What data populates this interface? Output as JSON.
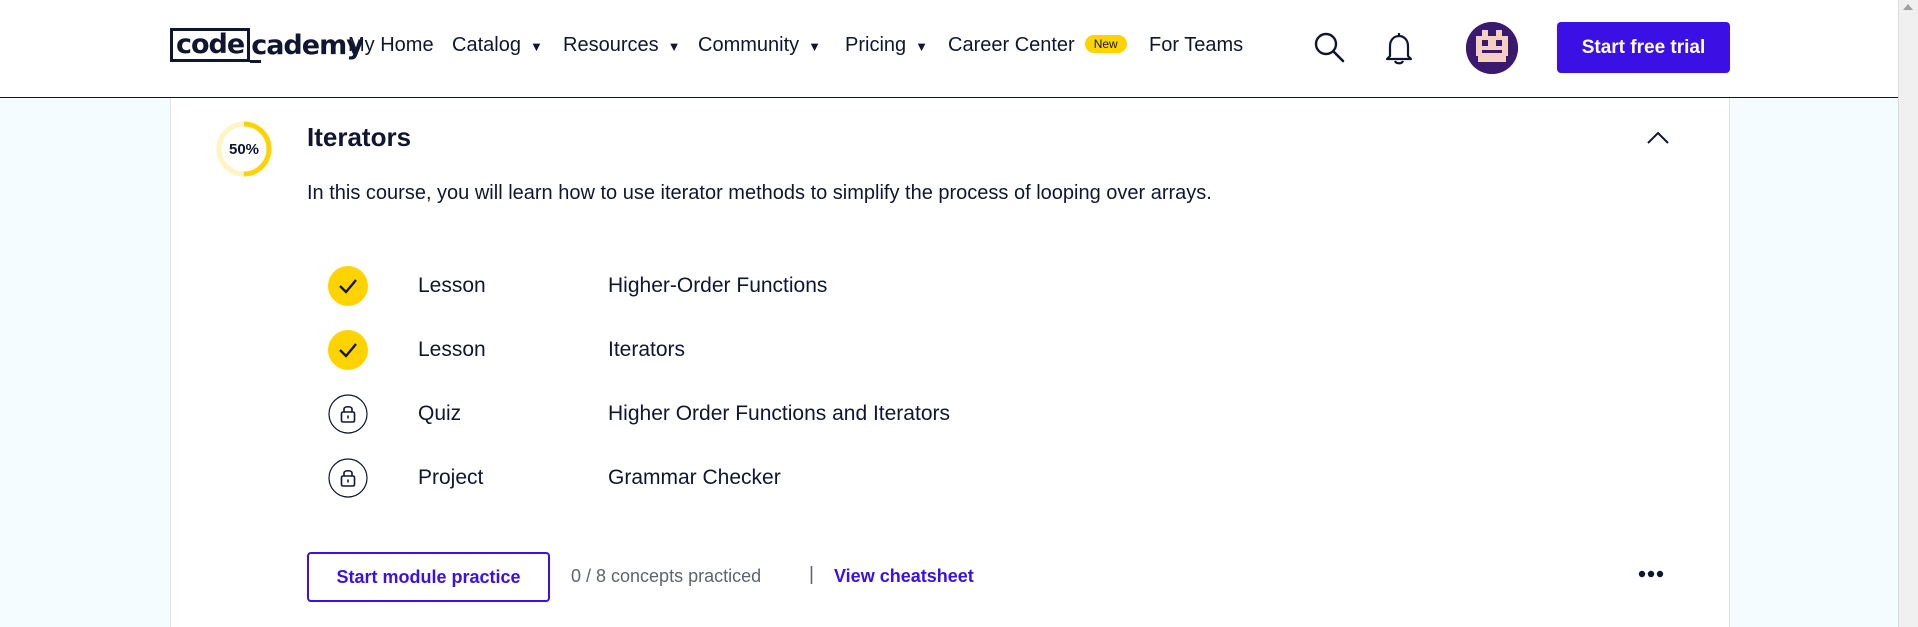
{
  "header": {
    "logo": {
      "boxed": "code",
      "rest": "cademy"
    },
    "nav": [
      {
        "label": "My Home",
        "has_caret": false
      },
      {
        "label": "Catalog",
        "has_caret": true
      },
      {
        "label": "Resources",
        "has_caret": true
      },
      {
        "label": "Community",
        "has_caret": true
      },
      {
        "label": "Pricing",
        "has_caret": true
      },
      {
        "label": "Career Center",
        "badge": "New"
      },
      {
        "label": "For Teams",
        "has_caret": false
      }
    ],
    "caret": "▼",
    "icons": {
      "search": "search-icon",
      "notifications": "bell-icon",
      "avatar": "user-avatar"
    },
    "cta_label": "Start free trial",
    "colors": {
      "accent": "#3a10e5",
      "badge": "#ffd300",
      "ink": "#10162f",
      "page_bg": "#f5fcff"
    }
  },
  "module": {
    "progress": 50,
    "progress_label": "50%",
    "title": "Iterators",
    "description": "In this course, you will learn how to use iterator methods to simplify the process of looping over arrays.",
    "items": [
      {
        "type": "Lesson",
        "name": "Higher-Order Functions",
        "status": "complete"
      },
      {
        "type": "Lesson",
        "name": "Iterators",
        "status": "complete"
      },
      {
        "type": "Quiz",
        "name": "Higher Order Functions and Iterators",
        "status": "locked"
      },
      {
        "type": "Project",
        "name": "Grammar Checker",
        "status": "locked"
      }
    ],
    "practice_button": "Start module practice",
    "concepts_text": "0 / 8 concepts practiced",
    "divider": "|",
    "cheatsheet_link": "View cheatsheet",
    "more_icon": "more-options-icon"
  }
}
